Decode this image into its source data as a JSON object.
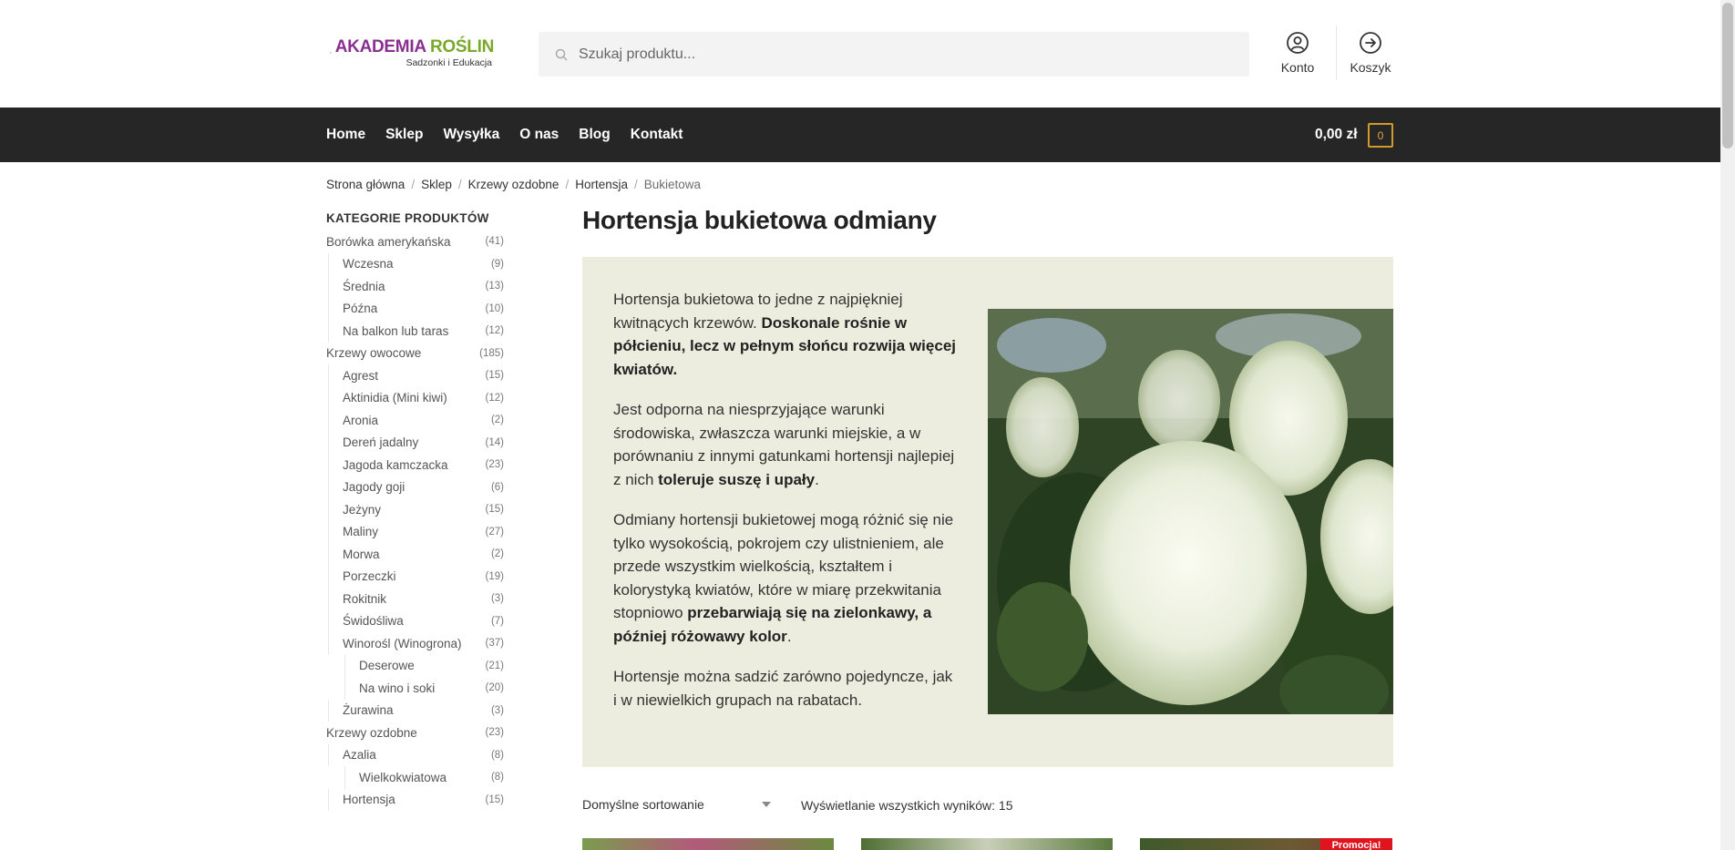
{
  "header": {
    "logo_title_part1": "AKADEMIA ",
    "logo_title_part2": "ROŚLIN",
    "logo_subtitle": "Sadzonki i Edukacja",
    "search_placeholder": "Szukaj produktu...",
    "account_label": "Konto",
    "cart_label": "Koszyk",
    "brand_colors": {
      "purple": "#8a2f8f",
      "green": "#7aa82a"
    }
  },
  "nav": {
    "items": [
      "Home",
      "Sklep",
      "Wysyłka",
      "O nas",
      "Blog",
      "Kontakt"
    ],
    "cart_total": "0,00 zł",
    "cart_count": "0"
  },
  "breadcrumb": {
    "items": [
      "Strona główna",
      "Sklep",
      "Krzewy ozdobne",
      "Hortensja"
    ],
    "current": "Bukietowa"
  },
  "sidebar": {
    "title": "KATEGORIE PRODUKTÓW",
    "categories": [
      {
        "label": "Borówka amerykańska",
        "count": "(41)"
      },
      {
        "label": "Wczesna",
        "count": "(9)"
      },
      {
        "label": "Średnia",
        "count": "(13)"
      },
      {
        "label": "Późna",
        "count": "(10)"
      },
      {
        "label": "Na balkon lub taras",
        "count": "(12)"
      },
      {
        "label": "Krzewy owocowe",
        "count": "(185)"
      },
      {
        "label": "Agrest",
        "count": "(15)"
      },
      {
        "label": "Aktinidia (Mini kiwi)",
        "count": "(12)"
      },
      {
        "label": "Aronia",
        "count": "(2)"
      },
      {
        "label": "Dereń jadalny",
        "count": "(14)"
      },
      {
        "label": "Jagoda kamczacka",
        "count": "(23)"
      },
      {
        "label": "Jagody goji",
        "count": "(6)"
      },
      {
        "label": "Jeżyny",
        "count": "(15)"
      },
      {
        "label": "Maliny",
        "count": "(27)"
      },
      {
        "label": "Morwa",
        "count": "(2)"
      },
      {
        "label": "Porzeczki",
        "count": "(19)"
      },
      {
        "label": "Rokitnik",
        "count": "(3)"
      },
      {
        "label": "Świdośliwa",
        "count": "(7)"
      },
      {
        "label": "Winorośl (Winogrona)",
        "count": "(37)"
      },
      {
        "label": "Deserowe",
        "count": "(21)"
      },
      {
        "label": "Na wino i soki",
        "count": "(20)"
      },
      {
        "label": "Żurawina",
        "count": "(3)"
      },
      {
        "label": "Krzewy ozdobne",
        "count": "(23)"
      },
      {
        "label": "Azalia",
        "count": "(8)"
      },
      {
        "label": "Wielkokwiatowa",
        "count": "(8)"
      },
      {
        "label": "Hortensja",
        "count": "(15)"
      }
    ]
  },
  "main": {
    "title": "Hortensja bukietowa odmiany",
    "p1_a": "Hortensja bukietowa to jedne z najpiękniej kwitnących krzewów. ",
    "p1_b": "Doskonale rośnie w półcieniu, lecz w pełnym słońcu rozwija więcej kwiatów.",
    "p2_a": "Jest odporna na niesprzyjające warunki środowiska, zwłaszcza warunki miejskie, a w porównaniu z innymi gatunkami hortensji najlepiej z nich ",
    "p2_b": "toleruje suszę i upały",
    "p2_c": ".",
    "p3_a": "Odmiany hortensji bukietowej mogą różnić się nie tylko wysokością, pokrojem czy ulistnieniem, ale przede wszystkim wielkością, kształtem i kolorystyką kwiatów, które w miarę przekwitania stopniowo ",
    "p3_b": "przebarwiają się na zielonkawy, a później różowawy kolor",
    "p3_c": ".",
    "p4": "Hortensje można sadzić zarówno pojedyncze, jak i w niewielkich grupach na rabatach.",
    "sort_label": "Domyślne sortowanie",
    "results_label": "Wyświetlanie wszystkich wyników: 15",
    "promo_label": "Promocja!"
  }
}
